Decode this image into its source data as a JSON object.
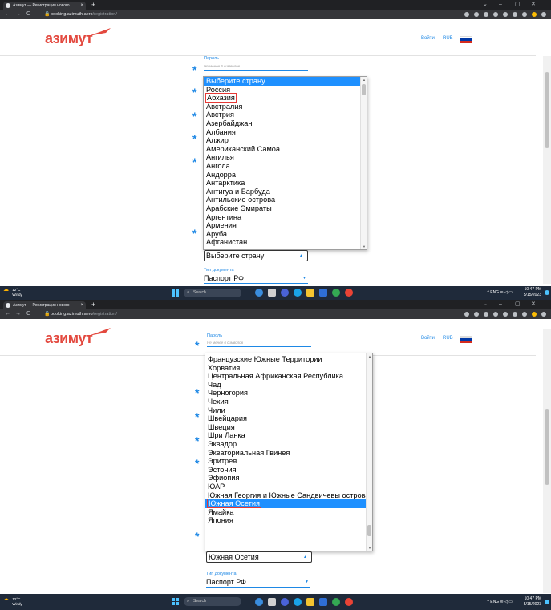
{
  "colors": {
    "accent": "#1e88e5",
    "logo": "#e3493f",
    "selected_option": "#1e90ff",
    "highlight_box": "#e53935"
  },
  "browser": {
    "tab_title": "Азимут — Регистрация нового",
    "tab_close": "×",
    "new_tab": "+",
    "url_host": "booking.azimuth.aero",
    "url_path": "/registration/",
    "back": "←",
    "forward": "→",
    "reload": "C",
    "lock": "🔒",
    "minimize": "–",
    "maximize": "▢",
    "close": "✕",
    "tab_list": "⌄"
  },
  "site": {
    "logo": "азимут",
    "login": "Войти",
    "currency": "RUB",
    "flag_colors": [
      "#ffffff",
      "#0039a6",
      "#d52b1e"
    ]
  },
  "form": {
    "password_label": "Пароль",
    "password_hint": "Не менее 6 символов",
    "required_star": "*",
    "country_select_arrow": "▲",
    "doc_type_label": "Тип документа",
    "doc_type_value": "Паспорт РФ",
    "doc_type_arrow": "▼"
  },
  "shot1": {
    "country_select_value": "Выберите страну",
    "options": [
      "Выберите страну",
      "Россия",
      "Абхазия",
      "Австралия",
      "Австрия",
      "Азербайджан",
      "Албания",
      "Алжир",
      "Американский Самоа",
      "Ангилья",
      "Ангола",
      "Андорра",
      "Антарктика",
      "Антигуа и Барбуда",
      "Антильские острова",
      "Арабские Эмираты",
      "Аргентина",
      "Армения",
      "Аруба",
      "Афганистан"
    ],
    "selected_index": 0,
    "boxed_index": 2
  },
  "shot2": {
    "country_select_value": "Южная Осетия",
    "options": [
      "Французские Южные Территории",
      "Хорватия",
      "Центральная Африканская Республика",
      "Чад",
      "Черногория",
      "Чехия",
      "Чили",
      "Швейцария",
      "Швеция",
      "Шри Ланка",
      "Эквадор",
      "Экваториальная Гвинея",
      "Эритрея",
      "Эстония",
      "Эфиопия",
      "ЮАР",
      "Южная Георгия и Южные Сандвичевы острова",
      "Южная Осетия",
      "Ямайка",
      "Япония"
    ],
    "selected_index": 17,
    "boxed_index": 17
  },
  "taskbar": {
    "temp": "12°C",
    "weather": "Windy",
    "search": "Search",
    "time": "10:47 PM",
    "date": "5/15/2023",
    "tray": "^ ENG ≋ ◁ ▭"
  },
  "icons": {
    "favicon": "azimuth-favicon-icon",
    "weather": "cloud-sun-icon",
    "start": "windows-start-icon",
    "search": "search-icon"
  }
}
